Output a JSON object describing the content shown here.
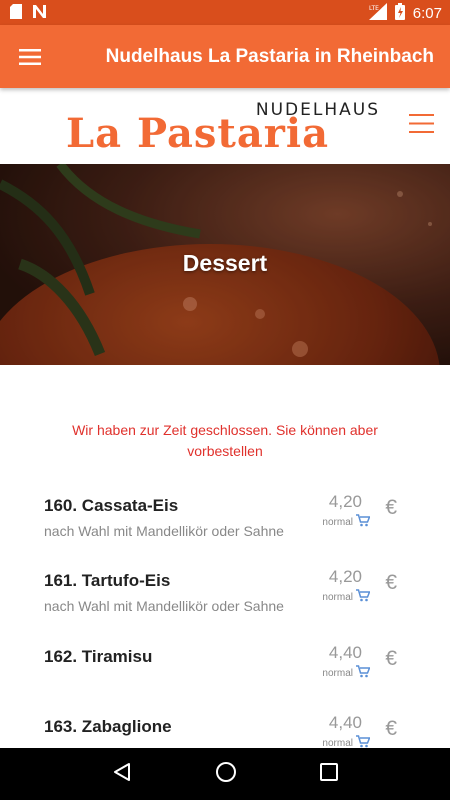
{
  "status": {
    "time": "6:07",
    "network": "LTE"
  },
  "appbar": {
    "title": "Nudelhaus La Pastaria in Rheinbach"
  },
  "logo": {
    "top_text": "NUDELHAUS",
    "main_text": "La Pastaria"
  },
  "hero": {
    "title": "Dessert"
  },
  "notice": "Wir haben zur Zeit geschlossen. Sie können aber vorbestellen",
  "items": [
    {
      "name": "160. Cassata-Eis",
      "desc": "nach Wahl mit Mandellikör oder Sahne",
      "price": "4,20",
      "size": "normal",
      "currency": "€"
    },
    {
      "name": "161. Tartufo-Eis",
      "desc": "nach Wahl mit Mandellikör oder Sahne",
      "price": "4,20",
      "size": "normal",
      "currency": "€"
    },
    {
      "name": "162. Tiramisu",
      "desc": "",
      "price": "4,40",
      "size": "normal",
      "currency": "€"
    },
    {
      "name": "163. Zabaglione",
      "desc": "",
      "price": "4,40",
      "size": "normal",
      "currency": "€"
    }
  ],
  "colors": {
    "brand_orange": "#f26a35",
    "status_orange": "#d94e1c",
    "notice_red": "#e0312c"
  },
  "icons": [
    "sd-card-icon",
    "n-notification-icon",
    "signal-icon",
    "battery-icon",
    "menu-icon",
    "cart-icon",
    "back-icon",
    "home-icon",
    "recents-icon"
  ]
}
